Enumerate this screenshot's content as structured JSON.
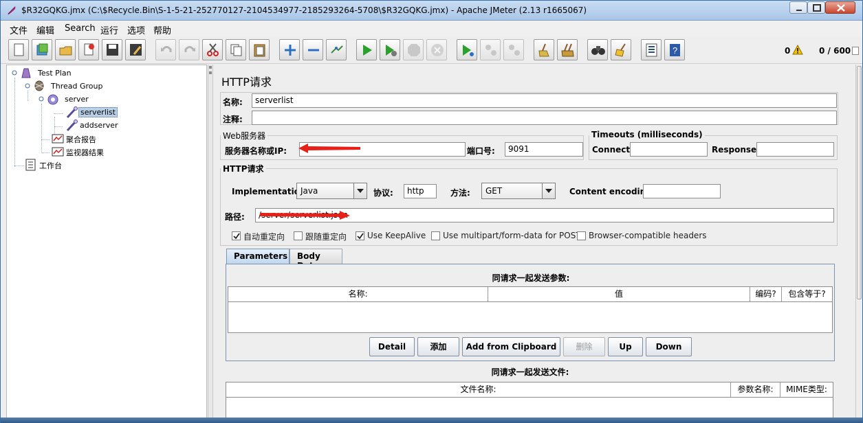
{
  "window": {
    "title": "$R32GQKG.jmx (C:\\$Recycle.Bin\\S-1-5-21-252770127-2104534977-2185293264-5708\\$R32GQKG.jmx) - Apache JMeter (2.13 r1665067)"
  },
  "menubar": [
    "文件",
    "编辑",
    "Search",
    "运行",
    "选项",
    "帮助"
  ],
  "toolbar": {
    "warnings": "0",
    "threads": "0 / 600"
  },
  "tree": {
    "items": [
      {
        "label": "Test Plan"
      },
      {
        "label": "Thread Group"
      },
      {
        "label": "server"
      },
      {
        "label": "serverlist"
      },
      {
        "label": "addserver"
      },
      {
        "label": "聚合报告"
      },
      {
        "label": "监视器结果"
      },
      {
        "label": "工作台"
      }
    ]
  },
  "sampler": {
    "title": "HTTP请求",
    "name_label": "名称:",
    "name_value": "serverlist",
    "comment_label": "注释:",
    "comment_value": "",
    "web_server": {
      "legend": "Web服务器",
      "server_label": "服务器名称或IP:",
      "server_value": "",
      "port_label": "端口号:",
      "port_value": "9091"
    },
    "timeouts": {
      "legend": "Timeouts (milliseconds)",
      "connect_label": "Connect:",
      "connect_value": "",
      "response_label": "Response:",
      "response_value": ""
    },
    "http_request": {
      "legend": "HTTP请求",
      "implementation_label": "Implementation:",
      "implementation_value": "Java",
      "protocol_label": "协议:",
      "protocol_value": "http",
      "method_label": "方法:",
      "method_value": "GET",
      "encoding_label": "Content encoding:",
      "encoding_value": "",
      "path_label": "路径:",
      "path_value": "/server/serverlist.json"
    },
    "checkboxes": [
      {
        "label": "自动重定向",
        "checked": true
      },
      {
        "label": "跟随重定向",
        "checked": false
      },
      {
        "label": "Use KeepAlive",
        "checked": true
      },
      {
        "label": "Use multipart/form-data for POST",
        "checked": false
      },
      {
        "label": "Browser-compatible headers",
        "checked": false
      }
    ],
    "tabs": [
      "Parameters",
      "Body Data"
    ],
    "params": {
      "title": "同请求一起发送参数:",
      "columns": [
        "名称:",
        "值",
        "编码?",
        "包含等于?"
      ],
      "buttons": [
        "Detail",
        "添加",
        "Add from Clipboard",
        "删除",
        "Up",
        "Down"
      ]
    },
    "files": {
      "title": "同请求一起发送文件:",
      "columns": [
        "文件名称:",
        "参数名称:",
        "MIME类型:"
      ]
    }
  }
}
